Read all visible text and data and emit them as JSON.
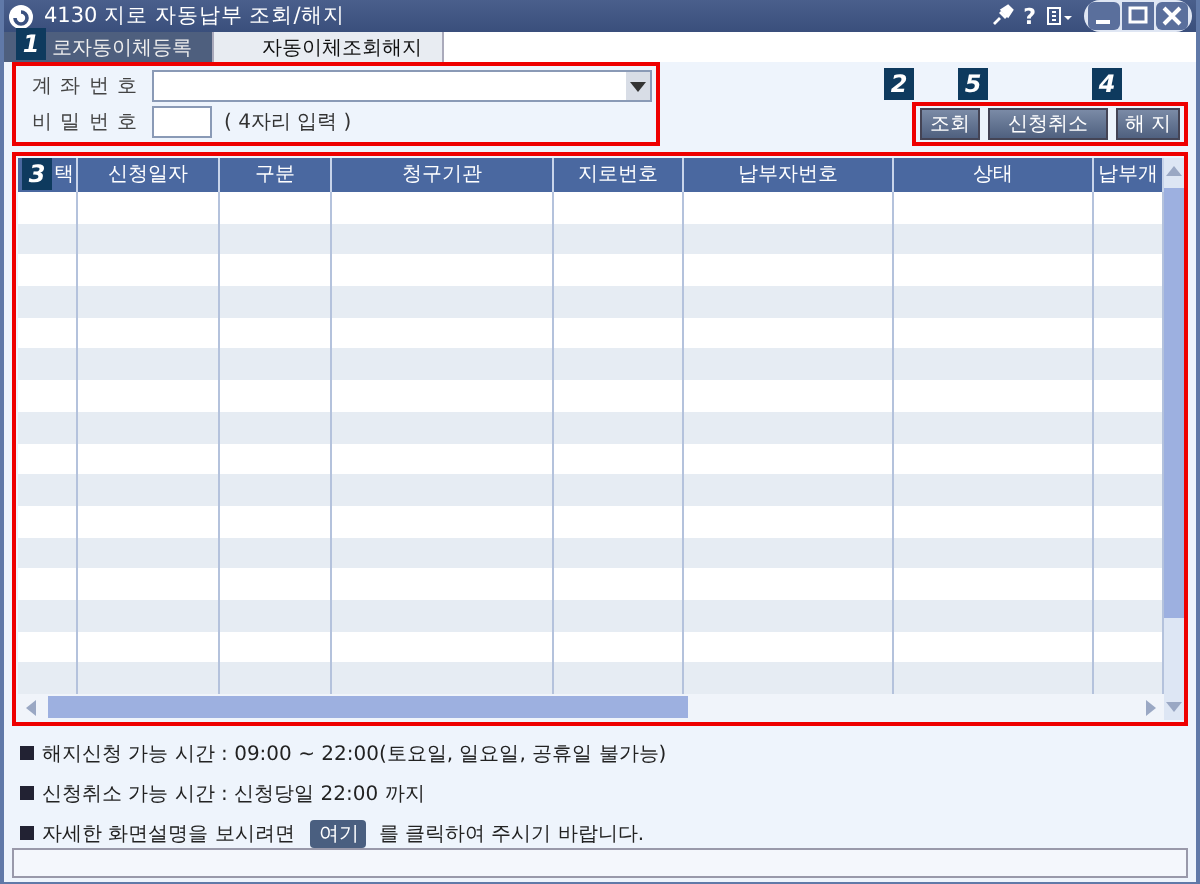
{
  "window": {
    "title": "4130 지로 자동납부 조회/해지",
    "help": "?"
  },
  "tabs": [
    {
      "label": "로자동이체등록",
      "selected": true,
      "badge": "1"
    },
    {
      "label": "자동이체조회해지",
      "selected": false
    }
  ],
  "form": {
    "account_label": "계 좌 번 호",
    "password_label": "비 밀 번 호",
    "password_hint": "( 4자리 입력 )"
  },
  "buttons": [
    {
      "label": "조회",
      "badge": "2"
    },
    {
      "label": "신청취소",
      "badge": "5"
    },
    {
      "label": "해 지",
      "badge": "4"
    }
  ],
  "table": {
    "badge": "3",
    "columns": [
      "택",
      "신청일자",
      "구분",
      "청구기관",
      "지로번호",
      "납부자번호",
      "상태",
      "납부개"
    ]
  },
  "notes": [
    {
      "text": "해지신청 가능 시간 : 09:00 ~ 22:00(토요일, 일요일, 공휴일 불가능)"
    },
    {
      "text": "신청취소 가능 시간 : 신청당일 22:00 까지"
    },
    {
      "text": "자세한 화면설명을 보시려면",
      "link": "여기",
      "after": "를 클릭하여 주시기 바랍니다."
    }
  ]
}
